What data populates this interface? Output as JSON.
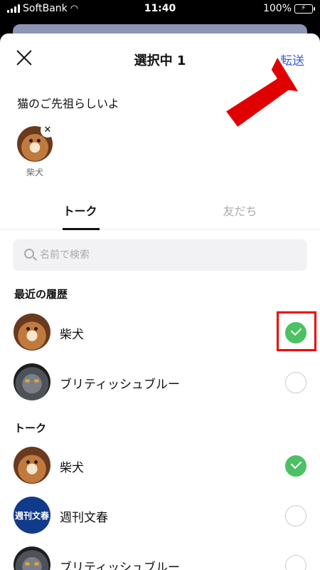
{
  "status_bar": {
    "carrier": "SoftBank",
    "time": "11:40",
    "battery": "100%"
  },
  "header": {
    "title": "選択中 1",
    "forward_label": "転送"
  },
  "message_preview": "猫のご先祖らしいよ",
  "selected_chip": {
    "name": "柴犬"
  },
  "tabs": [
    {
      "label": "トーク",
      "active": true
    },
    {
      "label": "友だち",
      "active": false
    }
  ],
  "search": {
    "placeholder": "名前で検索"
  },
  "sections": [
    {
      "title": "最近の履歴",
      "items": [
        {
          "name": "柴犬",
          "checked": true
        },
        {
          "name": "ブリティッシュブルー",
          "checked": false
        }
      ]
    },
    {
      "title": "トーク",
      "items": [
        {
          "name": "柴犬",
          "checked": true
        },
        {
          "name": "週刊文春",
          "checked": false
        },
        {
          "name": "ブリティッシュブルー",
          "checked": false
        }
      ]
    }
  ],
  "avatar_texts": {
    "bunshun": "週刊文春"
  },
  "colors": {
    "accent": "#3a5fd6",
    "check_green": "#4cc164",
    "annotation_red": "#e00000"
  }
}
